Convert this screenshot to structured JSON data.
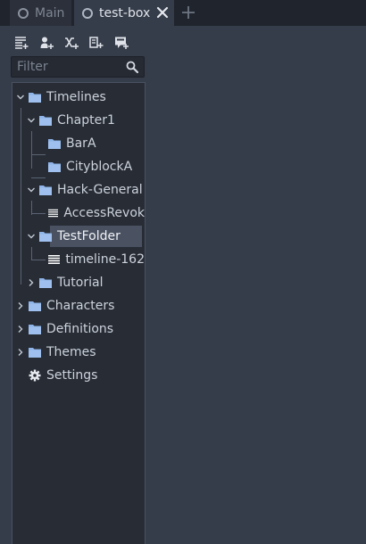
{
  "tabs": [
    {
      "label": "Main",
      "active": false
    },
    {
      "label": "test-box",
      "active": true
    }
  ],
  "filter": {
    "placeholder": "Filter",
    "value": ""
  },
  "tree": {
    "timelines": "Timelines",
    "chapter1": "Chapter1",
    "bara": "BarA",
    "cityblocka": "CityblockA",
    "hack_general": "Hack-General",
    "accessrevok": "AccessRevok",
    "testfolder": "TestFolder",
    "timeline162": "timeline-162",
    "tutorial": "Tutorial",
    "characters": "Characters",
    "definitions": "Definitions",
    "themes": "Themes",
    "settings": "Settings"
  },
  "colors": {
    "folder": "#8eb3e8",
    "background": "#363d4a",
    "panel": "#272c35",
    "selected": "#4a5262"
  },
  "icons": [
    "add-timeline-icon",
    "add-character-icon",
    "add-definition-icon",
    "add-theme-icon",
    "import-icon",
    "search-icon",
    "folder-icon",
    "timeline-icon",
    "gear-icon"
  ]
}
